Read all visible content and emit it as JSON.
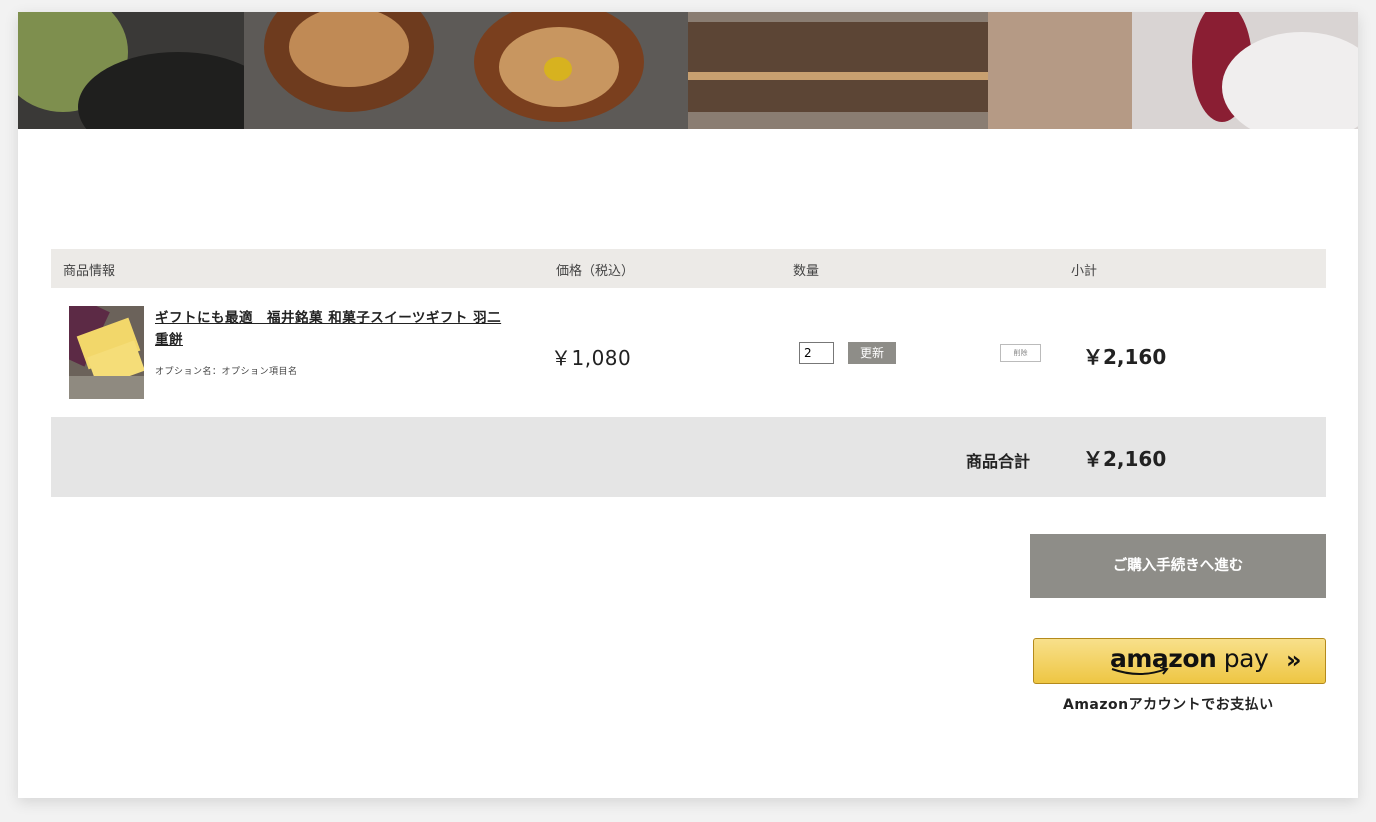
{
  "table": {
    "headers": {
      "product_info": "商品情報",
      "price": "価格（税込）",
      "quantity": "数量",
      "subtotal": "小計"
    }
  },
  "cart_item": {
    "title": "ギフトにも最適　福井銘菓 和菓子スイーツギフト 羽二重餅",
    "option": "オプション名：オプション項目名",
    "price": "￥1,080",
    "quantity": "2",
    "update_label": "更新",
    "delete_label": "削除",
    "subtotal": "￥2,160"
  },
  "totals": {
    "label": "商品合計",
    "value": "￥2,160"
  },
  "checkout": {
    "label": "ご購入手続きへ進む"
  },
  "amazon_pay": {
    "logo_bold": "amazon",
    "logo_light": " pay",
    "arrow": "»",
    "caption": "Amazonアカウントでお支払い",
    "color_top": "#f8e08b",
    "color_bottom": "#eec643"
  }
}
